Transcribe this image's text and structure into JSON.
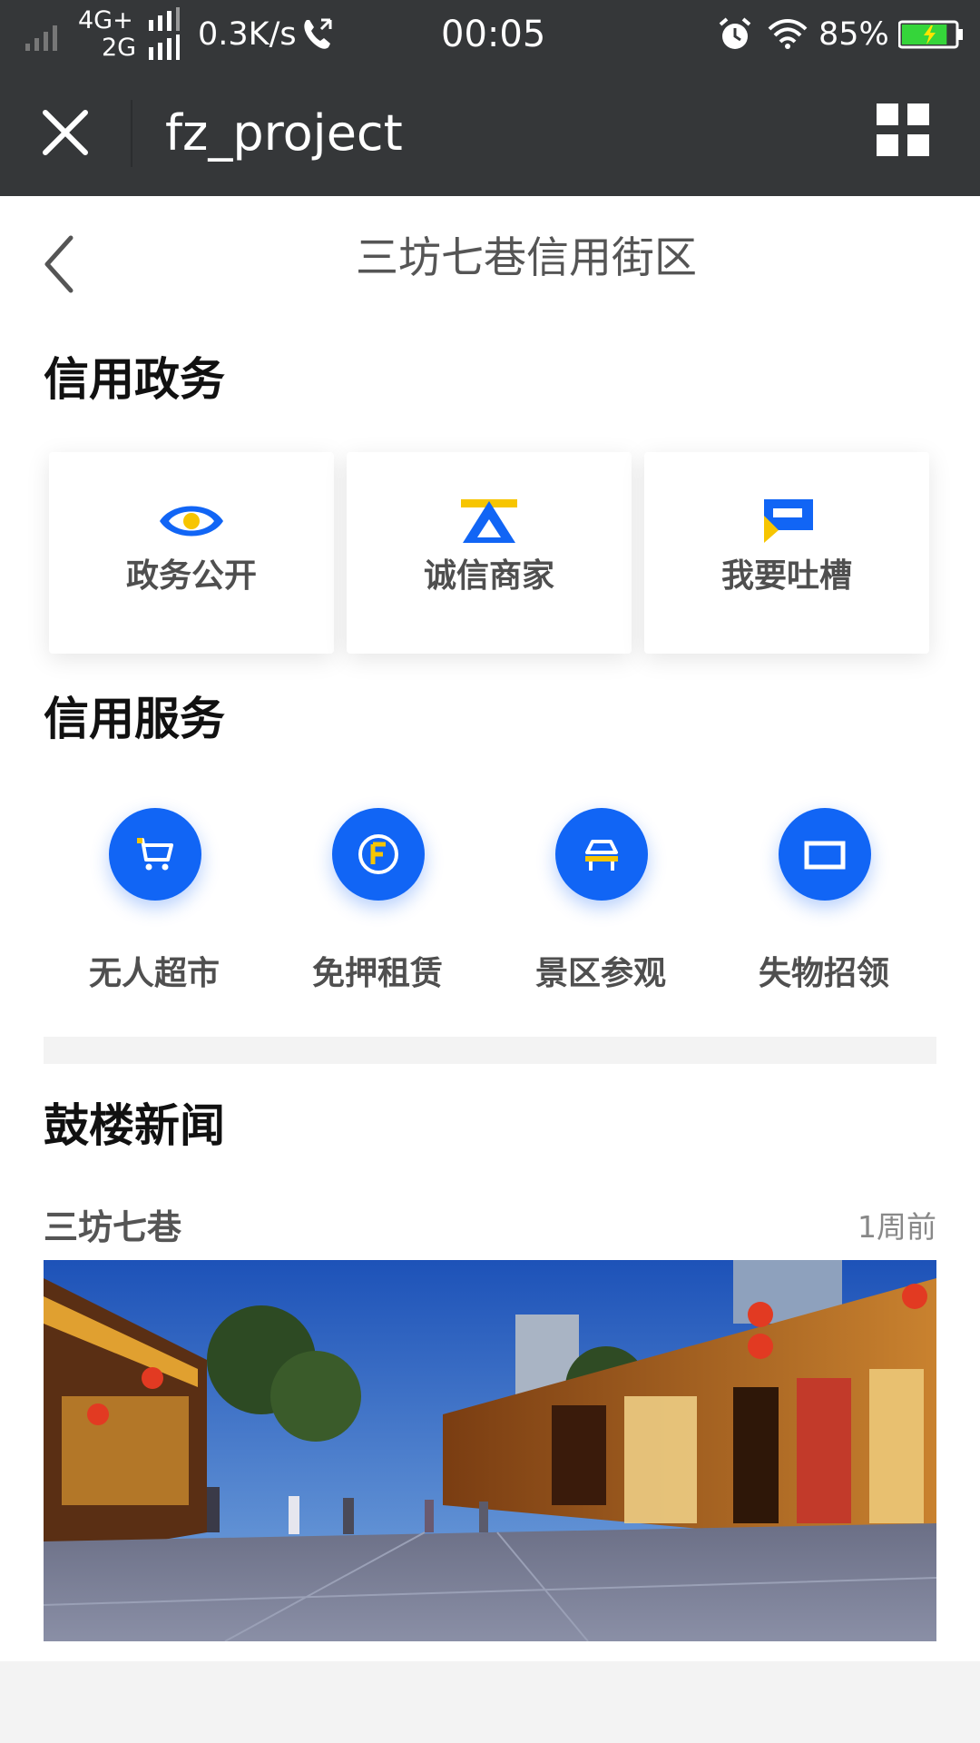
{
  "status_bar": {
    "network_top": "4G+",
    "network_bottom": "2G",
    "speed": "0.3K/s",
    "time": "00:05",
    "battery_percent": "85%",
    "battery_level": 0.85
  },
  "title_bar": {
    "title": "fz_project"
  },
  "page": {
    "title": "三坊七巷信用街区"
  },
  "credit_government": {
    "title": "信用政务",
    "cards": [
      {
        "label": "政务公开",
        "icon": "eye-icon"
      },
      {
        "label": "诚信商家",
        "icon": "triangle-badge-icon"
      },
      {
        "label": "我要吐槽",
        "icon": "comment-icon"
      }
    ]
  },
  "credit_services": {
    "title": "信用服务",
    "items": [
      {
        "label": "无人超市",
        "icon": "cart-icon"
      },
      {
        "label": "免押租赁",
        "icon": "coin-f-icon"
      },
      {
        "label": "景区参观",
        "icon": "gate-icon"
      },
      {
        "label": "失物招领",
        "icon": "box-icon"
      }
    ]
  },
  "news": {
    "title": "鼓楼新闻",
    "items": [
      {
        "source": "三坊七巷",
        "time": "1周前",
        "image": "street-photo"
      }
    ]
  },
  "colors": {
    "bar_bg": "#353739",
    "accent_blue": "#1165f5",
    "accent_yellow": "#f7c500",
    "battery_green": "#35d53a"
  }
}
